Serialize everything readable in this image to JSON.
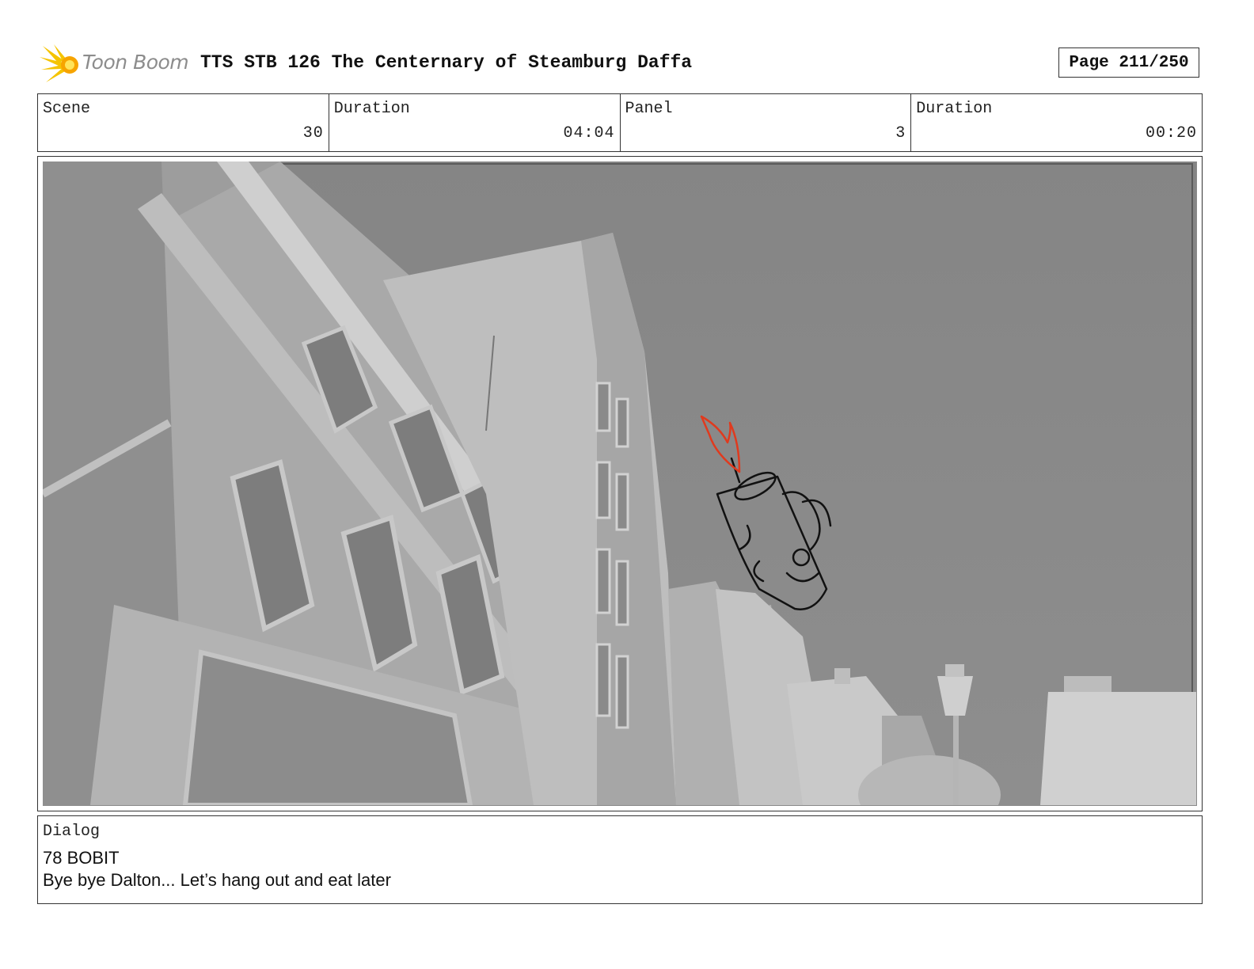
{
  "header": {
    "logo_text": "Toon Boom",
    "title": "TTS STB 126 The Centernary of Steamburg Daffa",
    "page": "Page 211/250"
  },
  "info": {
    "scene_label": "Scene",
    "scene_value": "30",
    "scene_duration_label": "Duration",
    "scene_duration_value": "04:04",
    "panel_label": "Panel",
    "panel_value": "3",
    "panel_duration_label": "Duration",
    "panel_duration_value": "00:20"
  },
  "dialog": {
    "label": "Dialog",
    "line1": "78 BOBIT",
    "line2": "Bye bye Dalton... Let’s hang out and eat later"
  },
  "colors": {
    "logo_accent": "#f5c400",
    "flame": "#e03a1e",
    "sky": "#8a8a8a"
  }
}
